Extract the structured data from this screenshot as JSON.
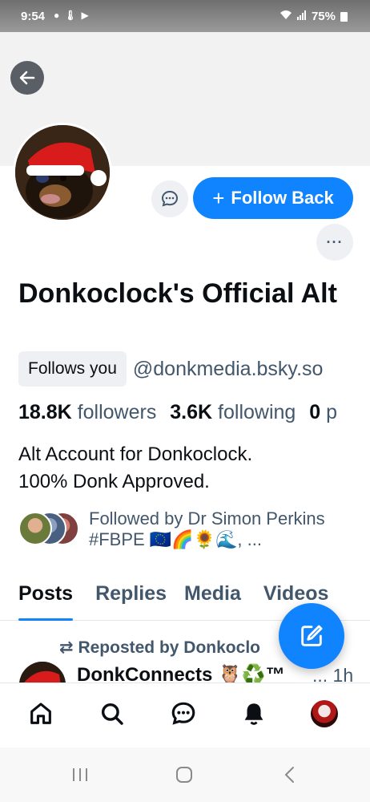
{
  "status_bar": {
    "time": "9:54",
    "battery": "75%",
    "icons": [
      "notification-icon",
      "thermometer-icon",
      "youtube-icon",
      "wifi-icon",
      "signal-icon",
      "battery-icon"
    ]
  },
  "profile": {
    "follow_button_label": "Follow Back",
    "display_name": "Donkoclock's Official Alt",
    "follows_you": "Follows you",
    "handle": "@donkmedia.bsky.so",
    "followers_count": "18.8K",
    "followers_label": "followers",
    "following_count": "3.6K",
    "following_label": "following",
    "posts_count": "0",
    "posts_label": "p",
    "bio": "Alt Account for Donkoclock.\n100% Donk Approved.",
    "followed_by": "Followed by Dr Simon Perkins #FBPE 🇪🇺🌈🌻🌊, ..."
  },
  "tabs": [
    {
      "label": "Posts",
      "active": true
    },
    {
      "label": "Replies",
      "active": false
    },
    {
      "label": "Media",
      "active": false
    },
    {
      "label": "Videos",
      "active": false
    }
  ],
  "post": {
    "repost_label": "Reposted by Donkoclo",
    "author": "DonkConnects 🦉♻️™",
    "time": "... 1h"
  },
  "colors": {
    "accent": "#1083fe",
    "text_primary": "#0b0f14",
    "text_secondary": "#42576c",
    "chip_bg": "#eef0f3"
  }
}
